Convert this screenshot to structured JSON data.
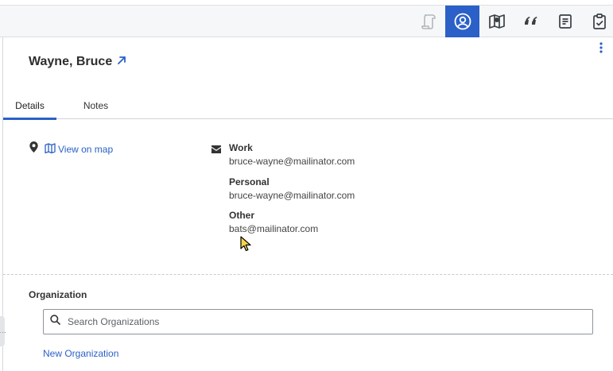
{
  "toolbar": {
    "buttons": [
      {
        "icon": "script-icon",
        "state": "disabled"
      },
      {
        "icon": "user-circle-icon",
        "state": "active"
      },
      {
        "icon": "map-icon",
        "state": "normal"
      },
      {
        "icon": "quote-icon",
        "state": "normal"
      },
      {
        "icon": "document-icon",
        "state": "normal"
      },
      {
        "icon": "clipboard-check-icon",
        "state": "normal"
      }
    ],
    "accent": "#2a60c8"
  },
  "contact": {
    "name": "Wayne, Bruce"
  },
  "tabs": [
    {
      "label": "Details",
      "active": true
    },
    {
      "label": "Notes",
      "active": false
    }
  ],
  "details": {
    "map_link": "View on map",
    "emails": [
      {
        "label": "Work",
        "value": "bruce-wayne@mailinator.com"
      },
      {
        "label": "Personal",
        "value": "bruce-wayne@mailinator.com"
      },
      {
        "label": "Other",
        "value": "bats@mailinator.com"
      }
    ]
  },
  "organization": {
    "heading": "Organization",
    "search_placeholder": "Search Organizations",
    "new_label": "New Organization"
  }
}
